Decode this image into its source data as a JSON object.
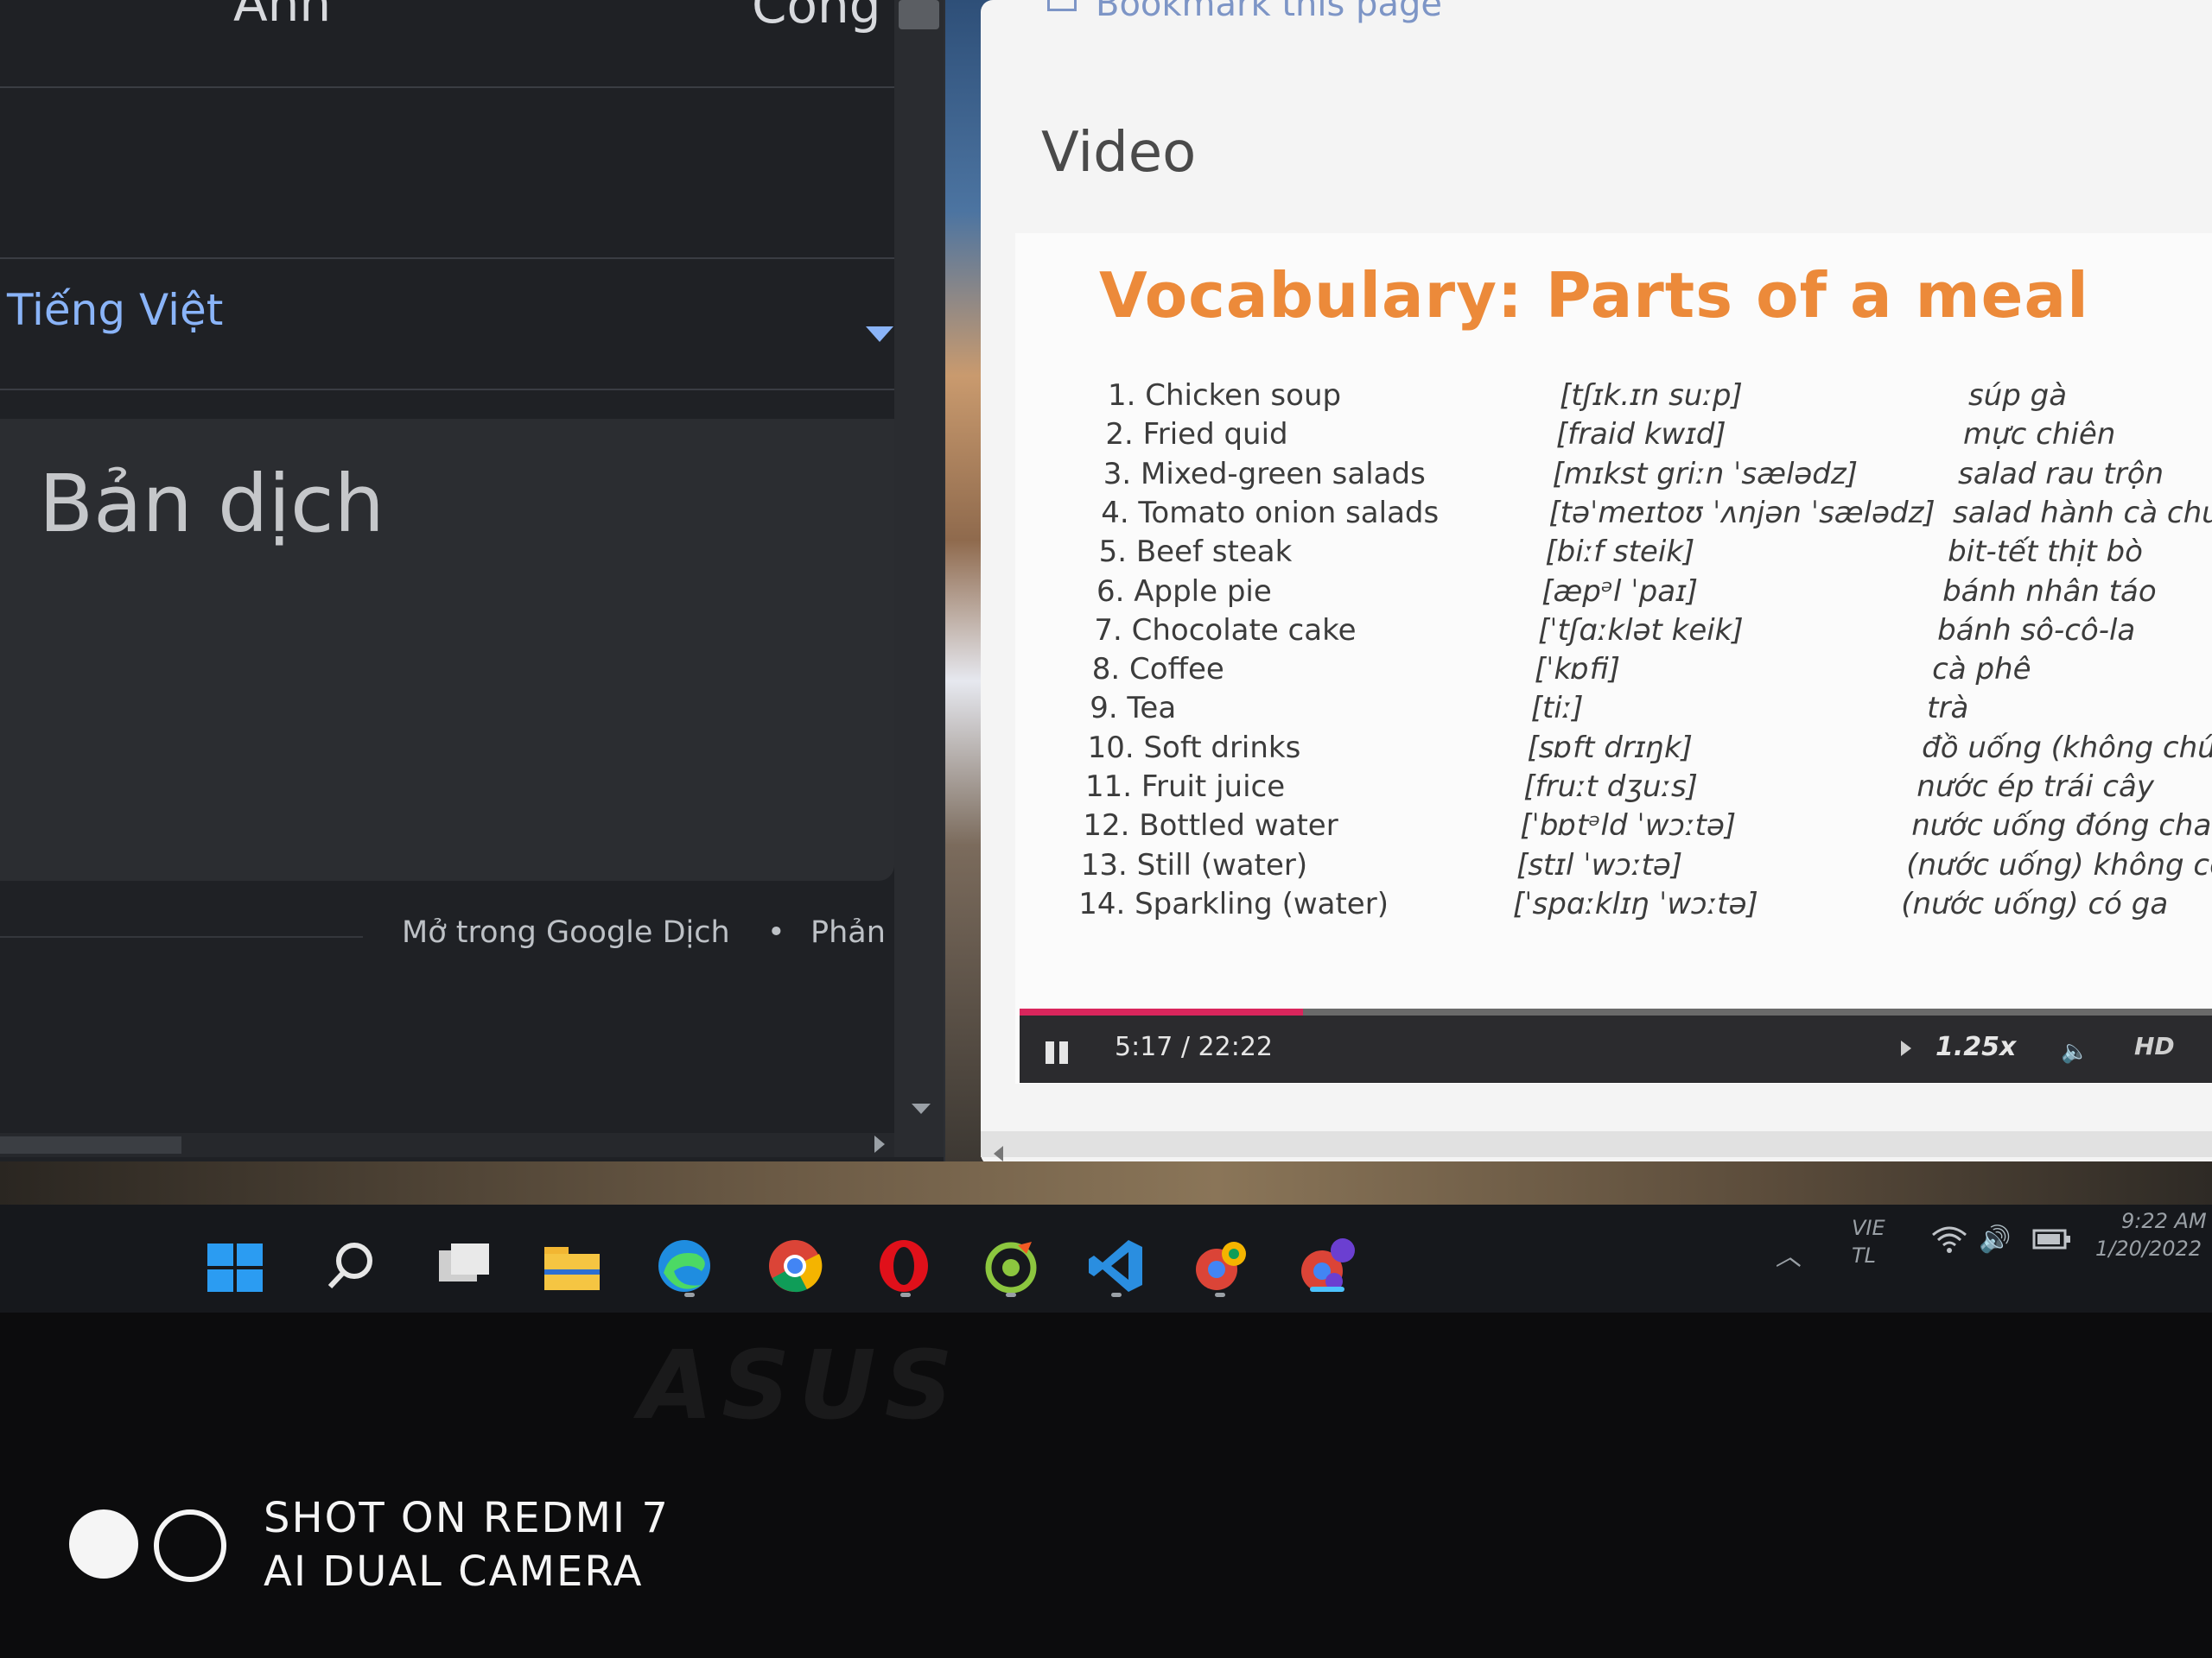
{
  "translate_panel": {
    "top_left_text": "Anh",
    "top_right_text": "Công c",
    "target_language": "Tiếng Việt",
    "output_placeholder": "Bản dịch",
    "footer_open_link": "Mở trong Google Dịch",
    "footer_separator": "•",
    "footer_feedback_link": "Phản h"
  },
  "page": {
    "bookmark_label": "Bookmark this page",
    "section_title": "Video"
  },
  "slide": {
    "title": "Vocabulary: Parts of a meal",
    "rows": [
      {
        "en": "1. Chicken soup",
        "ipa": "[tʃɪk.ɪn suːp]",
        "vi": "súp gà"
      },
      {
        "en": "2. Fried quid",
        "ipa": "[fraid kwɪd]",
        "vi": "mực chiên"
      },
      {
        "en": "3. Mixed-green salads",
        "ipa": "[mɪkst griːn ˈsælədz]",
        "vi": "salad rau trộn"
      },
      {
        "en": "4. Tomato onion salads",
        "ipa": "[təˈmeɪtoʊ ˈʌnjən ˈsælədz]",
        "vi": "salad hành cà chua"
      },
      {
        "en": "5. Beef steak",
        "ipa": "[biːf steik]",
        "vi": "bit-tết thịt bò"
      },
      {
        "en": "6. Apple pie",
        "ipa": "[æpᵊl ˈpaɪ]",
        "vi": "bánh nhân táo"
      },
      {
        "en": "7. Chocolate cake",
        "ipa": "[ˈtʃɑːklət keik]",
        "vi": "bánh sô-cô-la"
      },
      {
        "en": "8. Coffee",
        "ipa": "[ˈkɒfi]",
        "vi": "cà phê"
      },
      {
        "en": "9. Tea",
        "ipa": "[tiː]",
        "vi": "trà"
      },
      {
        "en": "10. Soft drinks",
        "ipa": "[sɒft drɪŋk]",
        "vi": "đồ uống (không chứa cồn)"
      },
      {
        "en": "11. Fruit juice",
        "ipa": "[fruːt dʒuːs]",
        "vi": "nước ép trái cây"
      },
      {
        "en": "12. Bottled water",
        "ipa": "[ˈbɒtᵊld ˈwɔːtə]",
        "vi": "nước uống đóng chai"
      },
      {
        "en": "13. Still (water)",
        "ipa": "[stɪl ˈwɔːtə]",
        "vi": "(nước uống) không có ga"
      },
      {
        "en": "14. Sparkling (water)",
        "ipa": "[ˈspɑːklɪŋ ˈwɔːtə]",
        "vi": "(nước uống) có ga"
      }
    ]
  },
  "player": {
    "time": "5:17 / 22:22",
    "speed": "1.25x",
    "quality": "HD",
    "progress_fraction": 0.2375,
    "accent_color": "#d9265c"
  },
  "taskbar": {
    "icons": [
      "windows-start",
      "search",
      "task-view",
      "file-explorer",
      "edge",
      "chrome",
      "opera",
      "app-green",
      "vscode",
      "chrome-profile",
      "chrome-profile-n"
    ],
    "language": "VIE",
    "language_sub": "TL",
    "clock_time": "9:22 AM",
    "clock_date": "1/20/2022"
  },
  "device": {
    "brand": "ASUS"
  },
  "watermark": {
    "line1": "SHOT ON REDMI 7",
    "line2": "AI DUAL CAMERA"
  },
  "colors": {
    "slide_title": "#ec8a3a",
    "link_blue": "#8ab4f8"
  }
}
